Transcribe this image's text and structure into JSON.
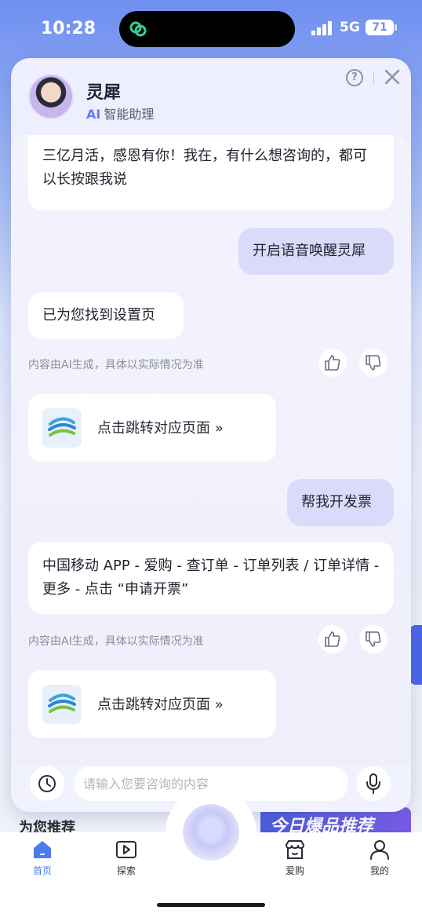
{
  "status": {
    "time": "10:28",
    "network": "5G",
    "battery": "71"
  },
  "assistant": {
    "name": "灵犀",
    "ai_mark": "AI",
    "subtitle": "智能助理"
  },
  "messages": {
    "m1": {
      "role": "bot",
      "text": "三亿月活，感恩有你！我在，有什么想咨询的，都可以长按跟我说"
    },
    "m2": {
      "role": "user",
      "text": "开启语音唤醒灵犀"
    },
    "m3": {
      "role": "bot",
      "text": "已为您找到设置页"
    },
    "notice1": "内容由AI生成，具体以实际情况为准",
    "card1": {
      "label": "点击跳转对应页面 »"
    },
    "m4": {
      "role": "user",
      "text": "帮我开发票"
    },
    "m5": {
      "role": "bot",
      "text": "中国移动 APP - 爱购 - 查订单 - 订单列表 / 订单详情 - 更多 - 点击 “申请开票”"
    },
    "notice2": "内容由AI生成，具体以实际情况为准",
    "card2": {
      "label": "点击跳转对应页面 »"
    }
  },
  "input": {
    "placeholder": "请输入您要咨询的内容"
  },
  "background": {
    "recommend": "为您推荐",
    "promo": "今日爆品推荐"
  },
  "tabbar": {
    "home": "首页",
    "explore": "探索",
    "shop": "爱购",
    "mine": "我的"
  },
  "colors": {
    "accent": "#4a7bf0",
    "user_bubble": "#dcdafb",
    "panel_bg": "#eef0ff"
  }
}
